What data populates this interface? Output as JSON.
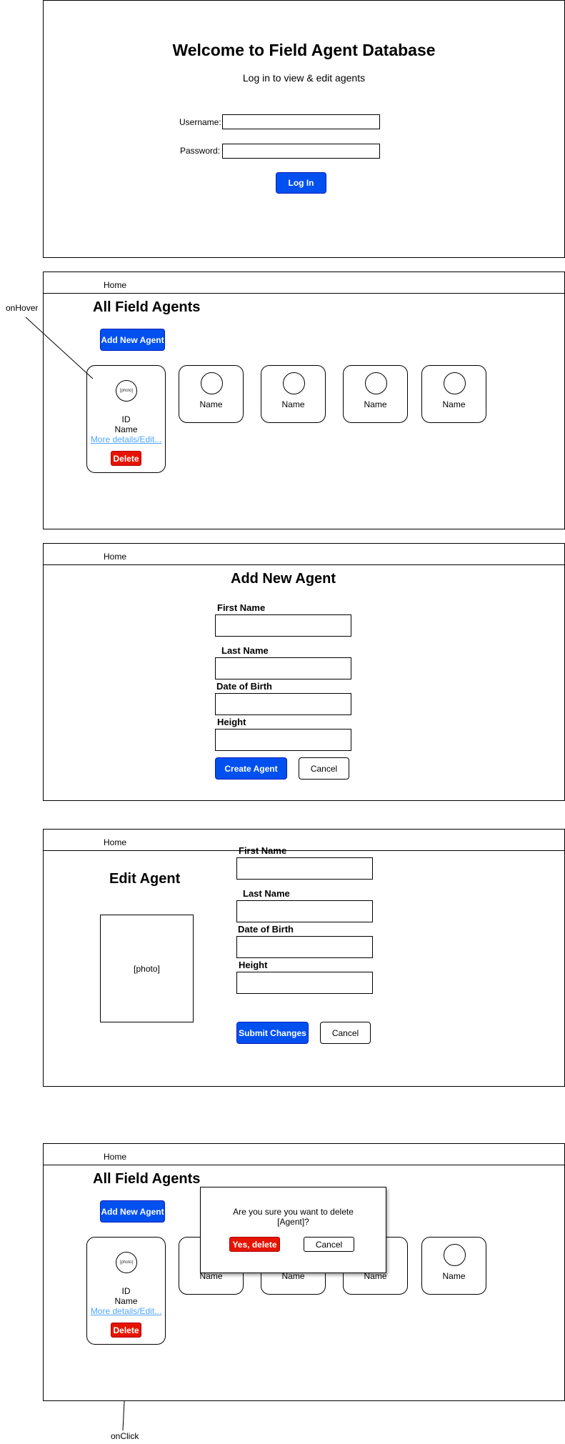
{
  "login": {
    "title": "Welcome to Field Agent Database",
    "subtitle": "Log in to view & edit agents",
    "username_label": "Username:",
    "password_label": "Password:",
    "login_button": "Log In"
  },
  "nav": {
    "home": "Home"
  },
  "list": {
    "title": "All Field Agents",
    "add_button": "Add New Agent",
    "hover_card": {
      "photo": "[photo]",
      "id": "ID",
      "name": "Name",
      "details_link": "More details/Edit...",
      "delete_button": "Delete"
    },
    "cards": [
      {
        "name": "Name"
      },
      {
        "name": "Name"
      },
      {
        "name": "Name"
      },
      {
        "name": "Name"
      }
    ]
  },
  "add_form": {
    "title": "Add New Agent",
    "first_name_label": "First Name",
    "last_name_label": "Last Name",
    "dob_label": "Date of Birth",
    "height_label": "Height",
    "create_button": "Create Agent",
    "cancel_button": "Cancel"
  },
  "edit_form": {
    "title": "Edit Agent",
    "photo": "[photo]",
    "first_name_label": "First Name",
    "last_name_label": "Last Name",
    "dob_label": "Date of Birth",
    "height_label": "Height",
    "submit_button": "Submit Changes",
    "cancel_button": "Cancel"
  },
  "delete_dialog": {
    "message_line1": "Are you sure you want to delete",
    "message_line2": "[Agent]?",
    "confirm_button": "Yes, delete",
    "cancel_button": "Cancel"
  },
  "annotations": {
    "on_hover": "onHover",
    "on_click": "onClick"
  },
  "colors": {
    "primary_blue": "#0050ef",
    "danger_red": "#e51400",
    "link_blue": "#4da6ff"
  }
}
